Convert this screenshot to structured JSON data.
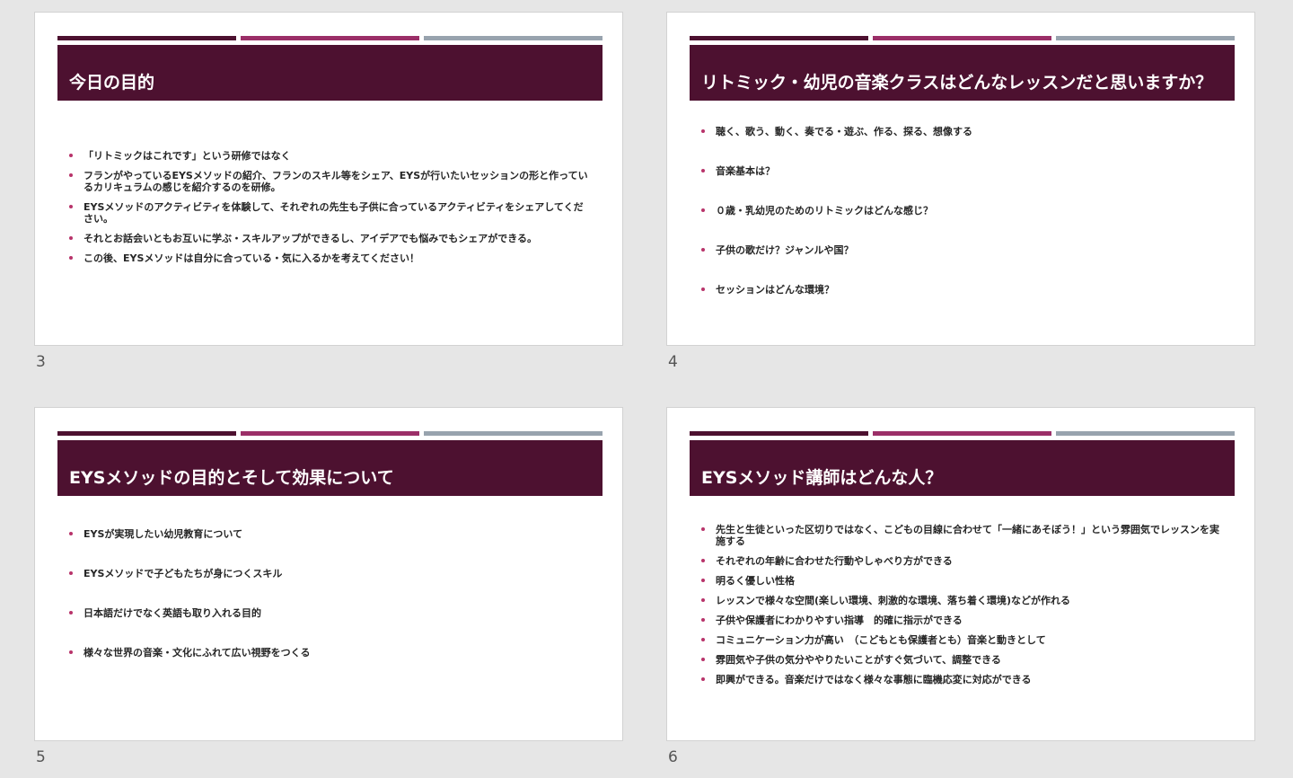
{
  "theme": {
    "title_band_color": "#4d1130",
    "accent_colors": [
      "#4d1130",
      "#9b2f68",
      "#98a3ae"
    ],
    "bullet_color": "#b8336a",
    "background": "#e6e6e6"
  },
  "slides": [
    {
      "number": "3",
      "title": "今日の目的",
      "bullets": [
        "「リトミックはこれです」という研修ではなく",
        "フランがやっているEYSメソッドの紹介、フランのスキル等をシェア、EYSが行いたいセッションの形と作っているカリキュラムの感じを紹介するのを研修。",
        "EYSメソッドのアクティビティを体験して、それぞれの先生も子供に合っているアクティビティをシェアしてください。",
        "それとお話会いともお互いに学ぶ・スキルアップができるし、アイデアでも悩みでもシェアができる。",
        "この後、EYSメソッドは自分に合っている・気に入るかを考えてください！"
      ]
    },
    {
      "number": "4",
      "title": "リトミック・幼児の音楽クラスはどんなレッスンだと思いますか？",
      "bullets": [
        "聴く、歌う、動く、奏でる・遊ぶ、作る、探る、想像する",
        "音楽基本は？",
        "０歳・乳幼児のためのリトミックはどんな感じ？",
        "子供の歌だけ？ジャンルや国？",
        "セッションはどんな環境？"
      ]
    },
    {
      "number": "5",
      "title": "EYSメソッドの目的とそして効果について",
      "bullets": [
        "EYSが実現したい幼児教育について",
        "EYSメソッドで子どもたちが身につくスキル",
        "日本語だけでなく英語も取り入れる目的",
        "様々な世界の音楽・文化にふれて広い視野をつくる"
      ]
    },
    {
      "number": "6",
      "title": "EYSメソッド講師はどんな人？",
      "bullets": [
        "先生と生徒といった区切りではなく、こどもの目線に合わせて「一緒にあそぼう！」という雰囲気でレッスンを実施する",
        "それぞれの年齢に合わせた行動やしゃべり方ができる",
        "明るく優しい性格",
        "レッスンで様々な空間(楽しい環境、刺激的な環境、落ち着く環境)などが作れる",
        "子供や保護者にわかりやすい指導　的確に指示ができる",
        "コミュニケーション力が高い　（こどもとも保護者とも）音楽と動きとして",
        "雰囲気や子供の気分ややりたいことがすぐ気づいて、調整できる",
        "即興ができる。音楽だけではなく様々な事態に臨機応変に対応ができる"
      ]
    }
  ]
}
